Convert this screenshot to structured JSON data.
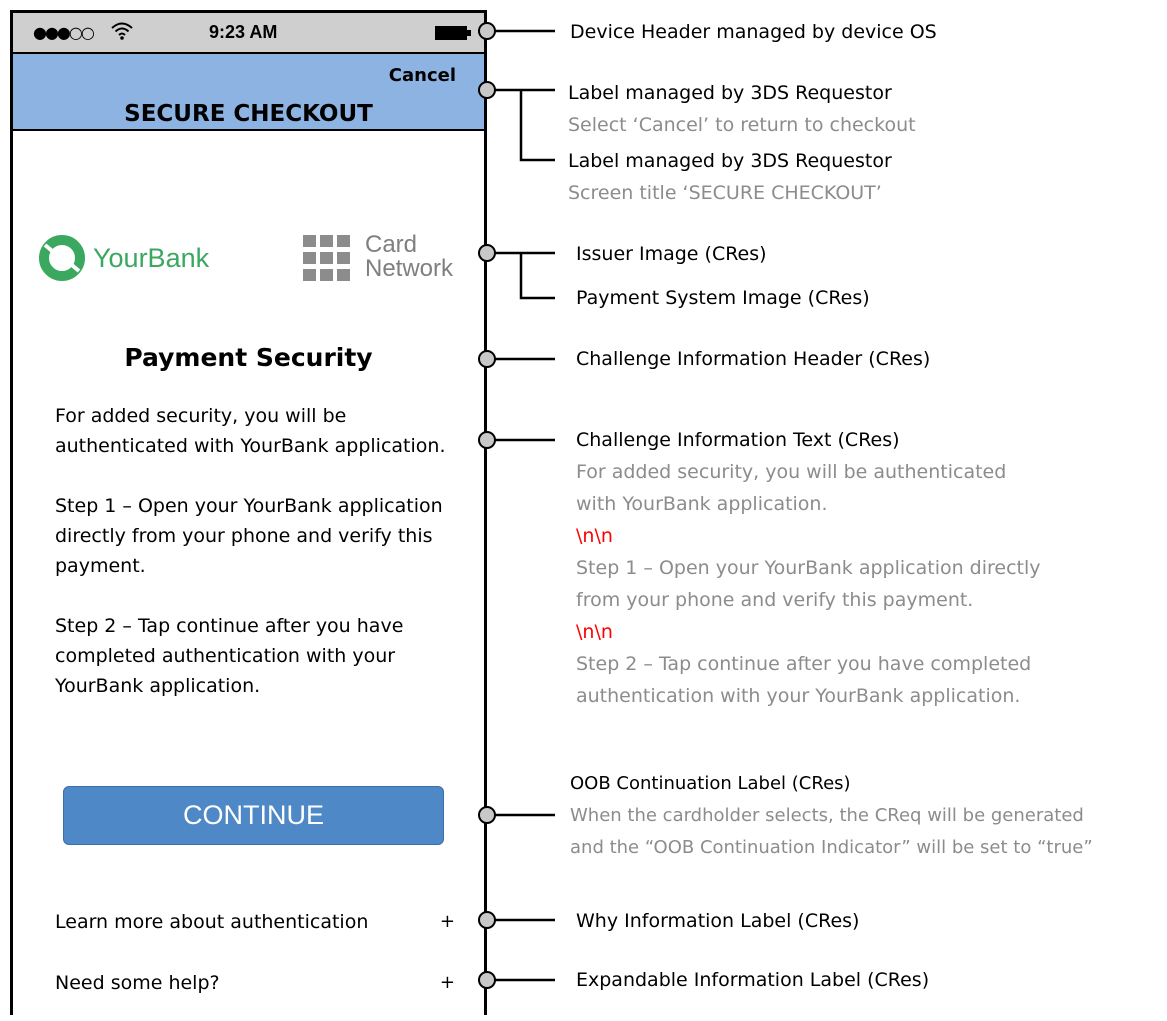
{
  "status_bar": {
    "signal": "●●●○○",
    "wifi_icon": "wifi-icon",
    "time": "9:23 AM",
    "battery_icon": "battery-icon"
  },
  "app_header": {
    "cancel_label": "Cancel",
    "title": "SECURE CHECKOUT"
  },
  "logos": {
    "issuer_name": "YourBank",
    "issuer_color": "#3aa85f",
    "network_line1": "Card",
    "network_line2": "Network"
  },
  "challenge": {
    "header": "Payment Security",
    "paragraphs": [
      "For added security, you will be authenticated with YourBank application.",
      "Step 1 – Open your YourBank application directly from your phone and verify this payment.",
      "Step 2 – Tap continue after you have completed authentication with your YourBank application."
    ],
    "continue_label": "CONTINUE",
    "why_label": "Learn more about authentication",
    "help_label": "Need some help?",
    "expand_symbol": "+"
  },
  "annotations": {
    "device_header": "Device Header managed by device OS",
    "cancel_label_title": "Label managed by 3DS Requestor",
    "cancel_label_desc": "Select ‘Cancel’ to return to checkout",
    "title_label_title": "Label managed by 3DS Requestor",
    "title_label_desc": "Screen title ‘SECURE CHECKOUT’",
    "issuer_image": "Issuer Image (CRes)",
    "payment_system_image": "Payment System Image (CRes)",
    "challenge_header": "Challenge Information Header (CRes)",
    "challenge_text_title": "Challenge Information Text (CRes)",
    "challenge_text_lines": [
      "For added security, you will be authenticated",
      "with YourBank application.",
      "\\n\\n",
      "Step 1 – Open your YourBank application directly",
      "from your phone and verify this payment.",
      "\\n\\n",
      "Step 2 – Tap continue after you have completed",
      "authentication with your YourBank application."
    ],
    "oob_title": "OOB Continuation Label (CRes)",
    "oob_line1": "When the cardholder selects, the CReq will be generated",
    "oob_line2": "and the “OOB Continuation Indicator” will be set to “true”",
    "why_info": "Why Information Label (CRes)",
    "expandable_info": "Expandable Information Label  (CRes)"
  },
  "colors": {
    "header_bg": "#8db3e2",
    "button_bg": "#4f88c6",
    "annotation_sub": "#8c8c8c",
    "newline_marker": "#ff0000"
  }
}
